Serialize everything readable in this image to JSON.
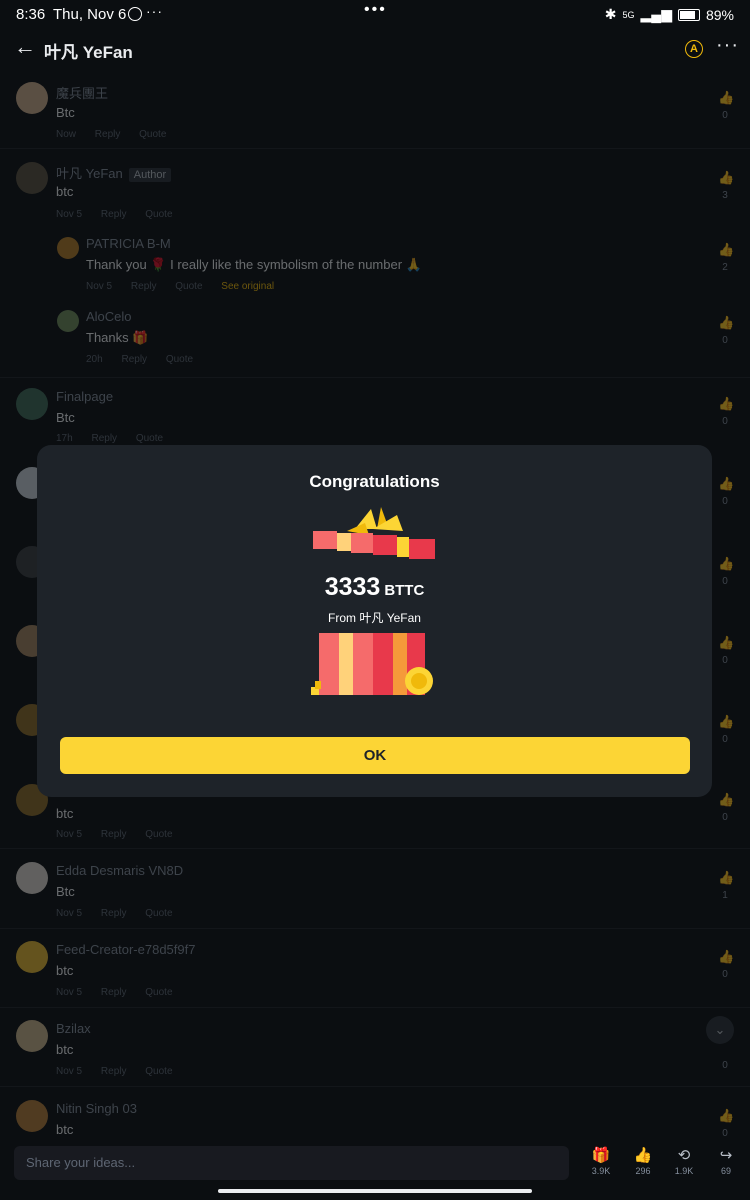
{
  "status": {
    "time": "8:36",
    "date": "Thu, Nov 6",
    "more": "···",
    "center": "•••",
    "network": "5G",
    "battery": "89%"
  },
  "header": {
    "title": "叶凡 YeFan",
    "translate_label": "A"
  },
  "comments": [
    {
      "name": "魔兵團王",
      "text": "Btc",
      "time": "Now",
      "reply": "Reply",
      "quote": "Quote",
      "likes": "0"
    },
    {
      "name": "叶凡 YeFan",
      "badge": "Author",
      "text": "btc",
      "time": "Nov 5",
      "reply": "Reply",
      "quote": "Quote",
      "likes": "3"
    },
    {
      "name": "PATRICIA B-M",
      "text": "Thank you 🌹 I really like the symbolism of the number 🙏",
      "time": "Nov 5",
      "reply": "Reply",
      "quote": "Quote",
      "see_original": "See original",
      "likes": "2"
    },
    {
      "name": "AloCelo",
      "text": "Thanks 🎁",
      "time": "20h",
      "reply": "Reply",
      "quote": "Quote",
      "likes": "0"
    },
    {
      "name": "Finalpage",
      "text": "Btc",
      "time": "17h",
      "reply": "Reply",
      "quote": "Quote",
      "likes": "0"
    },
    {
      "likes": "0"
    },
    {
      "likes": "0"
    },
    {
      "likes": "0"
    },
    {
      "likes": "0"
    },
    {
      "text": "btc",
      "time": "Nov 5",
      "reply": "Reply",
      "quote": "Quote",
      "likes": "0"
    },
    {
      "name": "Edda Desmaris VN8D",
      "text": "Btc",
      "time": "Nov 5",
      "reply": "Reply",
      "quote": "Quote",
      "likes": "1"
    },
    {
      "name": "Feed-Creator-e78d5f9f7",
      "text": "btc",
      "time": "Nov 5",
      "reply": "Reply",
      "quote": "Quote",
      "likes": "0"
    },
    {
      "name": "Bzilax",
      "text": "btc",
      "time": "Nov 5",
      "reply": "Reply",
      "quote": "Quote",
      "likes": "0"
    },
    {
      "name": "Nitin Singh 03",
      "text": "btc",
      "likes": "0"
    }
  ],
  "modal": {
    "title": "Congratulations",
    "amount": "3333",
    "unit": "BTTC",
    "from": "From 叶凡 YeFan",
    "ok": "OK"
  },
  "bottom": {
    "placeholder": "Share your ideas...",
    "gift_count": "3.9K",
    "like_count": "296",
    "repost_count": "1.9K",
    "share_count": "69"
  },
  "colors": {
    "accent": "#fcd535",
    "link": "#f0b90b",
    "bg": "#0b0e11",
    "modal_bg": "#1e2329"
  }
}
